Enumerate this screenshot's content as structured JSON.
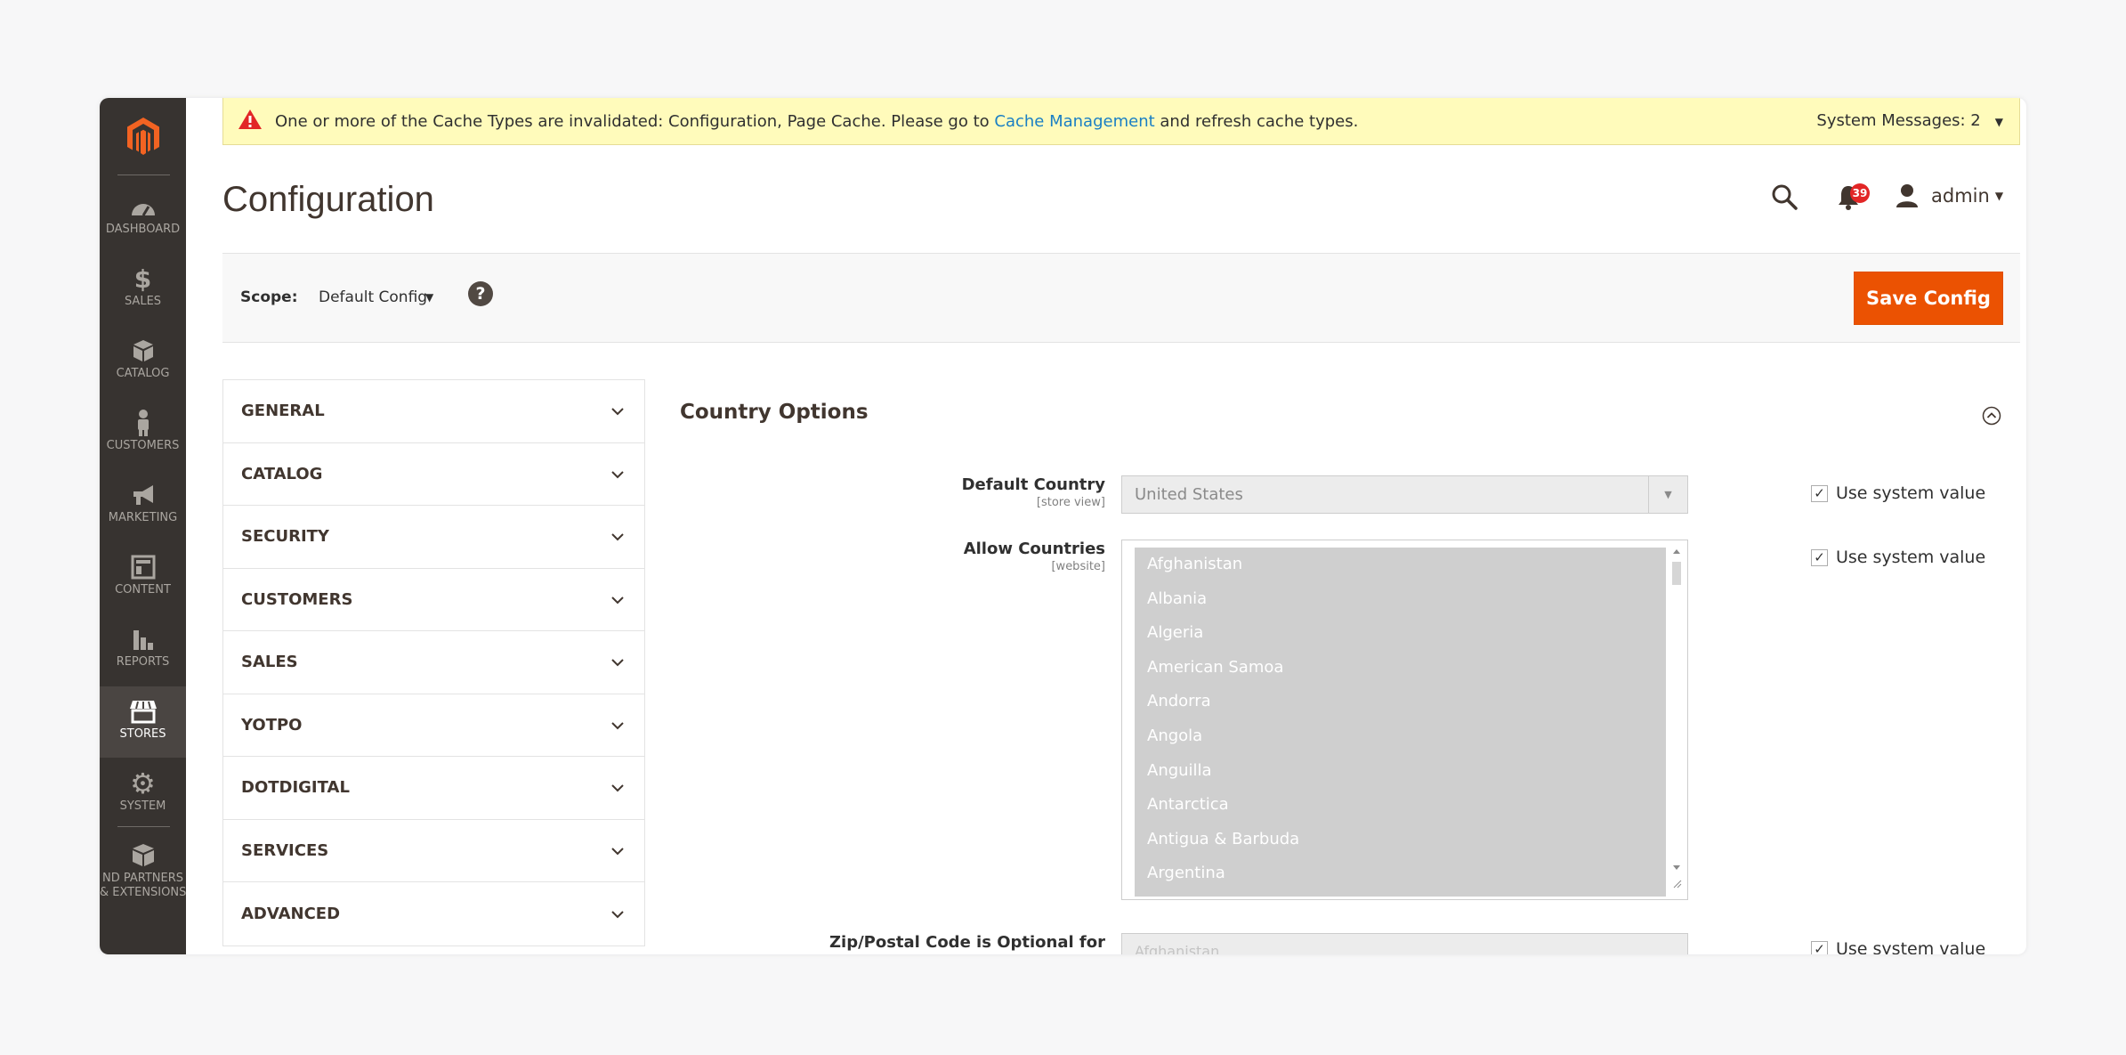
{
  "sidebar": {
    "items": [
      {
        "label": "DASHBOARD",
        "icon": "dashboard-icon"
      },
      {
        "label": "SALES",
        "icon": "dollar-icon"
      },
      {
        "label": "CATALOG",
        "icon": "box-icon"
      },
      {
        "label": "CUSTOMERS",
        "icon": "person-icon"
      },
      {
        "label": "MARKETING",
        "icon": "megaphone-icon"
      },
      {
        "label": "CONTENT",
        "icon": "layout-icon"
      },
      {
        "label": "REPORTS",
        "icon": "bar-chart-icon"
      },
      {
        "label": "STORES",
        "icon": "storefront-icon"
      },
      {
        "label": "SYSTEM",
        "icon": "gear-icon"
      },
      {
        "label_line1": "ND PARTNERS",
        "label_line2": "& EXTENSIONS",
        "icon": "cubes-icon"
      }
    ],
    "active": "STORES"
  },
  "message": {
    "text_before": "One or more of the Cache Types are invalidated: Configuration, Page Cache. Please go to",
    "link": "Cache Management",
    "text_after": "and refresh cache types.",
    "system_messages": "System Messages: 2"
  },
  "header": {
    "title": "Configuration",
    "notification_count": "39",
    "user": "admin"
  },
  "scope": {
    "label": "Scope:",
    "value": "Default Config",
    "help": "?",
    "save_label": "Save Config"
  },
  "tabs": [
    "GENERAL",
    "CATALOG",
    "SECURITY",
    "CUSTOMERS",
    "SALES",
    "YOTPO",
    "DOTDIGITAL",
    "SERVICES",
    "ADVANCED"
  ],
  "section": {
    "title": "Country Options",
    "default_country": {
      "label": "Default Country",
      "scope": "[store view]",
      "value": "United States",
      "use_system": "Use system value"
    },
    "allow_countries": {
      "label": "Allow Countries",
      "scope": "[website]",
      "options": [
        "Afghanistan",
        "Albania",
        "Algeria",
        "American Samoa",
        "Andorra",
        "Angola",
        "Anguilla",
        "Antarctica",
        "Antigua & Barbuda",
        "Argentina"
      ],
      "use_system": "Use system value"
    },
    "zip_optional": {
      "label": "Zip/Postal Code is Optional for",
      "value": "Afghanistan",
      "use_system": "Use system value"
    }
  },
  "colors": {
    "accent": "#eb5202",
    "sidebar": "#373330",
    "message_bg": "#fffbbb",
    "link": "#1a7fc4",
    "badge": "#e22626"
  }
}
